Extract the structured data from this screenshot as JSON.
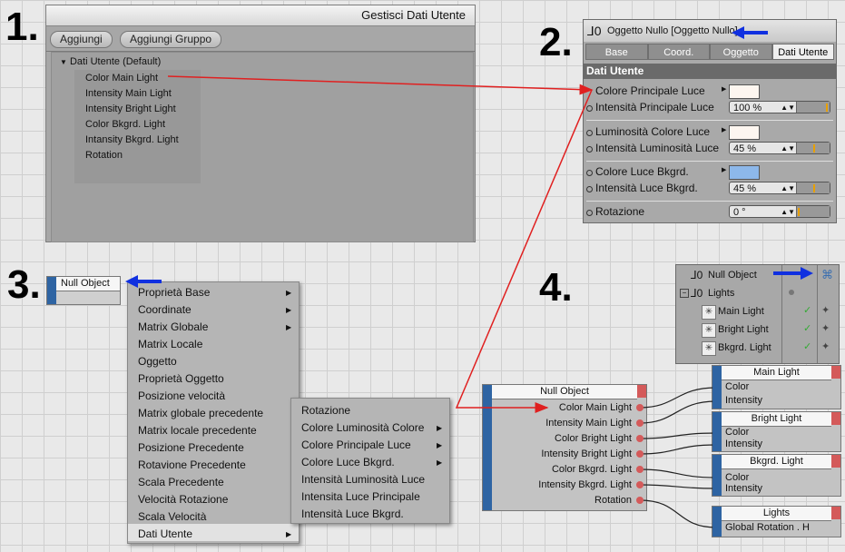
{
  "steps": {
    "one": "1.",
    "two": "2.",
    "three": "3.",
    "four": "4."
  },
  "panel1": {
    "title": "Gestisci Dati Utente",
    "buttons": [
      "Aggiungi",
      "Aggiungi Gruppo"
    ],
    "tree_root": "Dati Utente (Default)",
    "items": [
      "Color Main Light",
      "Intensity Main Light",
      "Intensity Bright Light",
      "Color Bkgrd. Light",
      "Intansity Bkgrd. Light",
      "Rotation"
    ]
  },
  "panel2": {
    "title": "Oggetto Nullo [Oggetto Nullo]",
    "tabs": [
      "Base",
      "Coord.",
      "Oggetto",
      "Dati Utente"
    ],
    "section": "Dati Utente",
    "rows": {
      "color_main": "Colore Principale Luce",
      "intensity_main": "Intensità Principale Luce",
      "intensity_main_value": "100 %",
      "color_lum": "Luminosità Colore Luce",
      "intensity_lum": "Intensità Luminosità Luce",
      "intensity_lum_value": "45 %",
      "color_bkgrd": "Colore Luce Bkgrd.",
      "intensity_bkgrd": "Intensità Luce Bkgrd.",
      "intensity_bkgrd_value": "45 %",
      "rotation": "Rotazione",
      "rotation_value": "0 °"
    },
    "swatch_colors": {
      "main": "#fdf6f0",
      "lum": "#fdf6f0",
      "bkgrd": "#8db8ea"
    }
  },
  "panel3": {
    "node_title": "Null Object",
    "menu": [
      "Proprietà Base",
      "Coordinate",
      "Matrix Globale",
      "Matrix Locale",
      "Oggetto",
      "Proprietà Oggetto",
      "Posizione velocità",
      "Matrix globale precedente",
      "Matrix locale precedente",
      "Posizione Precedente",
      "Rotavione Precedente",
      "Scala Precedente",
      "Velocità Rotazione",
      "Scala Velocità",
      "Dati Utente"
    ],
    "submenu": [
      "Rotazione",
      "Colore Luminosità Colore",
      "Colore Principale Luce",
      "Colore Luce Bkgrd.",
      "Intensità Luminosità Luce",
      "Intensita Luce Principale",
      "Intensità Luce Bkgrd."
    ]
  },
  "panel4": {
    "objects": [
      "Null Object",
      "Lights",
      "Main Light",
      "Bright Light",
      "Bkgrd. Light"
    ],
    "null_node": {
      "title": "Null Object",
      "ports": [
        "Color Main Light",
        "Intensity Main Light",
        "Color Bright Light",
        "Intensity Bright Light",
        "Color Bkgrd. Light",
        "Intensity Bkgrd. Light",
        "Rotation"
      ]
    },
    "main_light": {
      "title": "Main Light",
      "ports": [
        "Color",
        "Intensity"
      ]
    },
    "bright_light": {
      "title": "Bright Light",
      "ports": [
        "Color",
        "Intensity"
      ]
    },
    "bkgrd_light": {
      "title": "Bkgrd. Light",
      "ports": [
        "Color",
        "Intensity"
      ]
    },
    "lights": {
      "title": "Lights",
      "ports": [
        "Global Rotation . H"
      ]
    }
  },
  "colors": {
    "accent_red": "#e02020",
    "accent_blue": "#1030e0",
    "port_blue": "#2e64a3",
    "port_red": "#d45a5a"
  }
}
